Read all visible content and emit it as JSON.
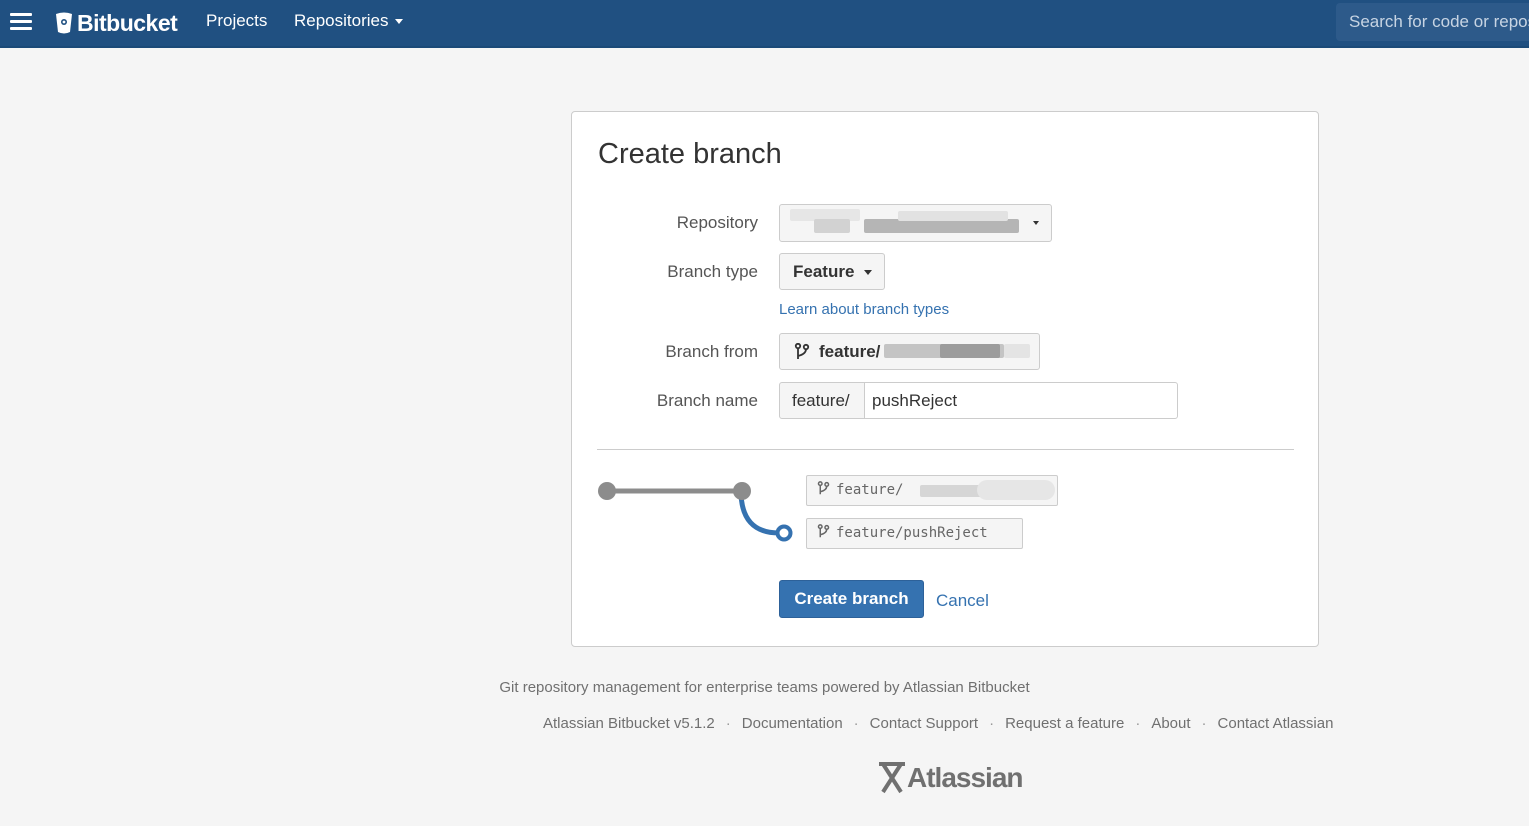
{
  "header": {
    "app_name": "Bitbucket",
    "nav": [
      {
        "label": "Projects"
      },
      {
        "label": "Repositories"
      }
    ],
    "search_placeholder": "Search for code or repositories"
  },
  "form": {
    "title": "Create branch",
    "repository_label": "Repository",
    "branch_type_label": "Branch type",
    "branch_type_value": "Feature",
    "learn_link": "Learn about branch types",
    "branch_from_label": "Branch from",
    "branch_from_prefix": "feature/",
    "branch_name_label": "Branch name",
    "branch_name_prefix": "feature/",
    "branch_name_value": "pushReject",
    "diagram": {
      "source_ref": "feature/",
      "new_ref": "feature/pushReject"
    },
    "submit_label": "Create branch",
    "cancel_label": "Cancel"
  },
  "footer": {
    "tagline": "Git repository management for enterprise teams powered by Atlassian Bitbucket",
    "links": [
      "Atlassian Bitbucket v5.1.2",
      "Documentation",
      "Contact Support",
      "Request a feature",
      "About",
      "Contact Atlassian"
    ],
    "logo_text": "Atlassian"
  },
  "colors": {
    "header_bg": "#205081",
    "primary": "#3572b0",
    "graph_gray": "#8c8c8c"
  }
}
